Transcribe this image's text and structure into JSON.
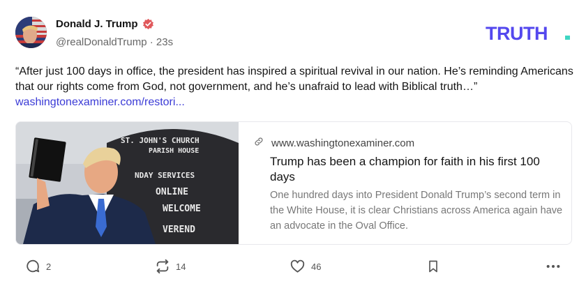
{
  "post": {
    "author_name": "Donald J. Trump",
    "handle": "@realDonaldTrump",
    "separator": "·",
    "timestamp": "23s",
    "text": "“After just 100 days in office, the president has inspired a spiritual revival in our nation. He’s reminding Americans that our rights come from God, not government, and he’s unafraid to lead with Biblical truth…”",
    "link_text": "washingtonexaminer.com/restori..."
  },
  "brand": {
    "logo_text": "TRUTH",
    "logo_color": "#5448ee",
    "verified_color": "#e0585b",
    "link_color": "#3b3bd6"
  },
  "card": {
    "domain": "www.washingtonexaminer.com",
    "title": "Trump has been a champion for faith in his first 100 days",
    "description": "One hundred days into President Donald Trump’s second term in the White House, it is clear Christians across America again have an advocate in the Oval Office.",
    "image_sign_text": [
      "ST. JOHN'S CHURCH",
      "PARISH HOUSE",
      "NDAY SERVICES",
      "ONLINE",
      "WELCOME",
      "VEREND"
    ]
  },
  "actions": {
    "reply_count": "2",
    "retruth_count": "14",
    "like_count": "46"
  },
  "icons": [
    "verified-badge-icon",
    "link-icon",
    "reply-icon",
    "retruth-icon",
    "like-icon",
    "bookmark-icon",
    "more-icon"
  ]
}
